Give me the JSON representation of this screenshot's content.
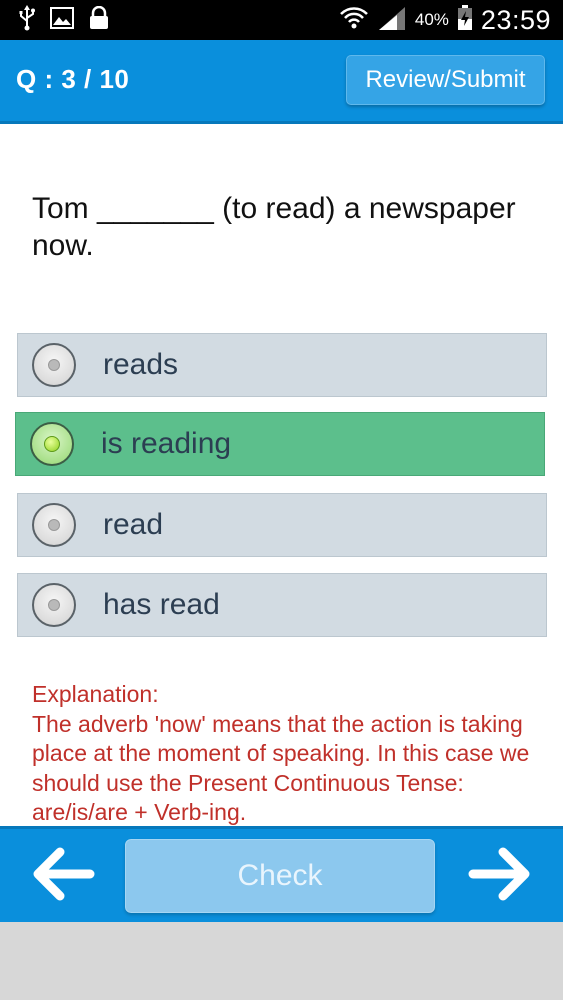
{
  "status_bar": {
    "icons_left": [
      "usb-icon",
      "image-icon",
      "lock-icon"
    ],
    "icons_right": [
      "wifi-icon",
      "signal-icon",
      "battery-icon"
    ],
    "battery": "40%",
    "time": "23:59"
  },
  "header": {
    "counter": "Q : 3 / 10",
    "review_label": "Review/Submit"
  },
  "question": {
    "text": "Tom _______ (to read) a newspaper now."
  },
  "options": [
    {
      "label": "reads",
      "selected": false
    },
    {
      "label": "is reading",
      "selected": true
    },
    {
      "label": "read",
      "selected": false
    },
    {
      "label": "has read",
      "selected": false
    }
  ],
  "explanation": {
    "title": "Explanation:",
    "text": "The adverb 'now' means that the action is taking place at the moment of speaking. In this case we should use the Present Continuous Tense: are/is/are + Verb-ing."
  },
  "bottom_bar": {
    "prev_icon": "arrow-left-icon",
    "check_label": "Check",
    "next_icon": "arrow-right-icon"
  },
  "colors": {
    "primary_blue": "#0a8fdc",
    "selected_green": "#5cbf8c",
    "option_gray": "#d2dbe2",
    "explanation_red": "#c0302a"
  }
}
